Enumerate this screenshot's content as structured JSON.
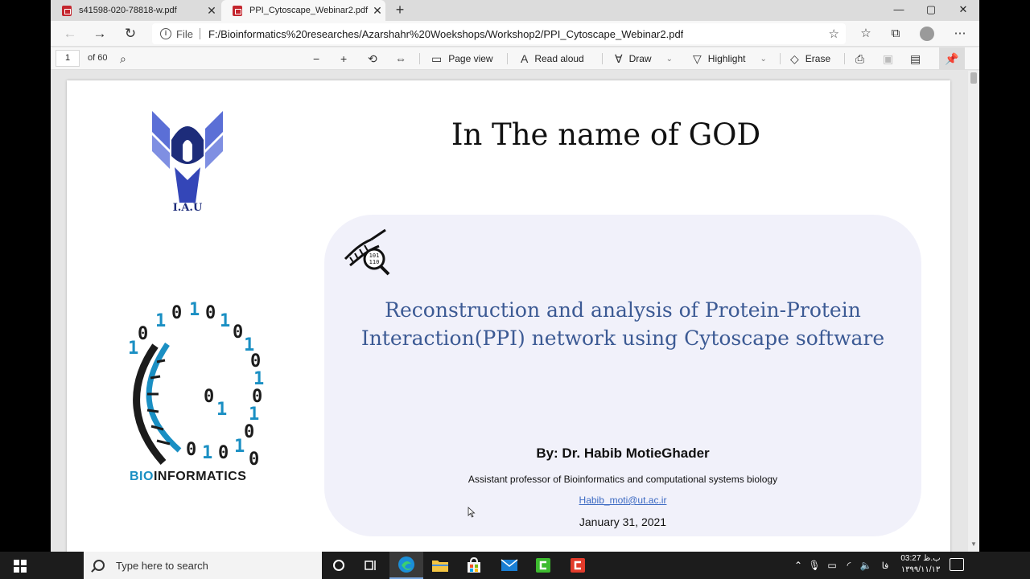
{
  "tabs": [
    {
      "title": "s41598-020-78818-w.pdf",
      "active": false
    },
    {
      "title": "PPI_Cytoscape_Webinar2.pdf",
      "active": true
    }
  ],
  "window_controls": {
    "minimize": "—",
    "maximize": "▢",
    "close": "✕"
  },
  "address_bar": {
    "scheme": "File",
    "url": "F:/Bioinformatics%20researches/Azarshahr%20Woekshops/Workshop2/PPI_Cytoscape_Webinar2.pdf"
  },
  "pdf_toolbar": {
    "page_number": "1",
    "page_count": "of 60",
    "page_view": "Page view",
    "read_aloud": "Read aloud",
    "draw": "Draw",
    "highlight": "Highlight",
    "erase": "Erase"
  },
  "slide": {
    "heading": "In The name of GOD",
    "logo_text": "I.A.U",
    "bioinformatics_label_prefix": "BIO",
    "bioinformatics_label_suffix": "INFORMATICS",
    "dna_icon_text_top": "101",
    "dna_icon_text_bottom": "110",
    "title_line1": "Reconstruction and analysis of Protein-Protein",
    "title_line2": "Interaction(PPI) network using Cytoscape software",
    "author": "By: Dr. Habib MotieGhader",
    "affiliation": "Assistant professor of Bioinformatics and computational systems biology",
    "email": "Habib_moti@ut.ac.ir",
    "date": "January 31, 2021"
  },
  "colors": {
    "title_blue": "#3c5a94",
    "iau_blue": "#5b6fd6",
    "bioinformatics_cyan": "#1a8fc3",
    "panel_bg": "#f1f1fa",
    "link_blue": "#3b69c2"
  },
  "taskbar": {
    "search_placeholder": "Type here to search",
    "clock_time": "03:27 ب.ظ",
    "clock_date": "۱۳۹۹/۱۱/۱۳",
    "language": "فا"
  }
}
